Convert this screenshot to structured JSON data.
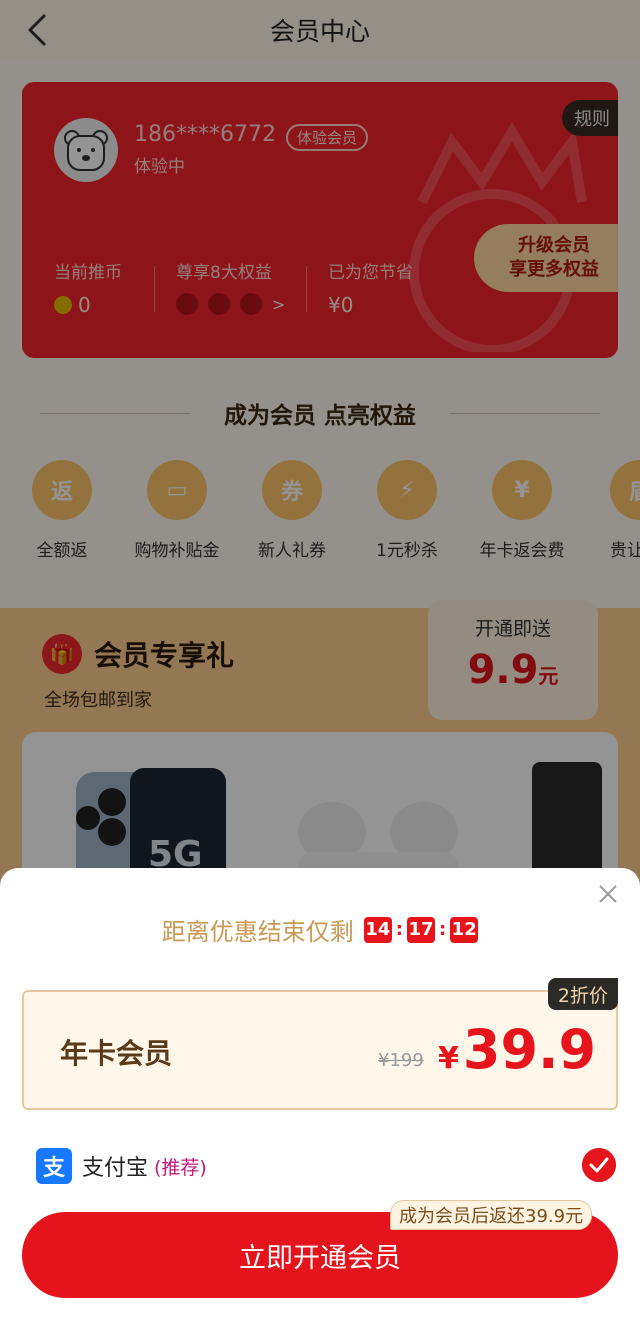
{
  "header": {
    "title": "会员中心"
  },
  "card": {
    "phone": "186****6772",
    "tag": "体验会员",
    "status": "体验中",
    "rules": "规则",
    "upgrade_line1": "升级会员",
    "upgrade_line2": "享更多权益",
    "stats": [
      {
        "label": "当前推币",
        "value": "0"
      },
      {
        "label": "尊享8大权益",
        "value": ">"
      },
      {
        "label": "已为您节省",
        "value": "¥0"
      }
    ]
  },
  "section_heading": "成为会员 点亮权益",
  "benefits": [
    {
      "label": "全额返",
      "glyph": "返"
    },
    {
      "label": "购物补贴金",
      "glyph": "▭"
    },
    {
      "label": "新人礼券",
      "glyph": "券"
    },
    {
      "label": "1元秒杀",
      "glyph": "⚡"
    },
    {
      "label": "年卡返会费",
      "glyph": "¥"
    },
    {
      "label": "贵让",
      "glyph": "盾"
    }
  ],
  "gift": {
    "title": "会员专享礼",
    "subtitle": "全场包邮到家",
    "offer_label": "开通即送",
    "offer_amount": "9.9",
    "offer_unit": "元",
    "product_5g": "5G"
  },
  "sheet": {
    "countdown_text": "距离优惠结束仅剩",
    "hours": "14",
    "minutes": "17",
    "seconds": "12",
    "plan_name": "年卡会员",
    "original_price": "¥199",
    "currency": "¥",
    "price": "39.9",
    "discount_badge": "2折价",
    "payment_method": "支付宝",
    "payment_tag": "(推荐)",
    "cta_label": "立即开通会员",
    "cta_tip": "成为会员后返还39.9元"
  },
  "colors": {
    "accent": "#e5131b",
    "gold": "#c99a55"
  }
}
